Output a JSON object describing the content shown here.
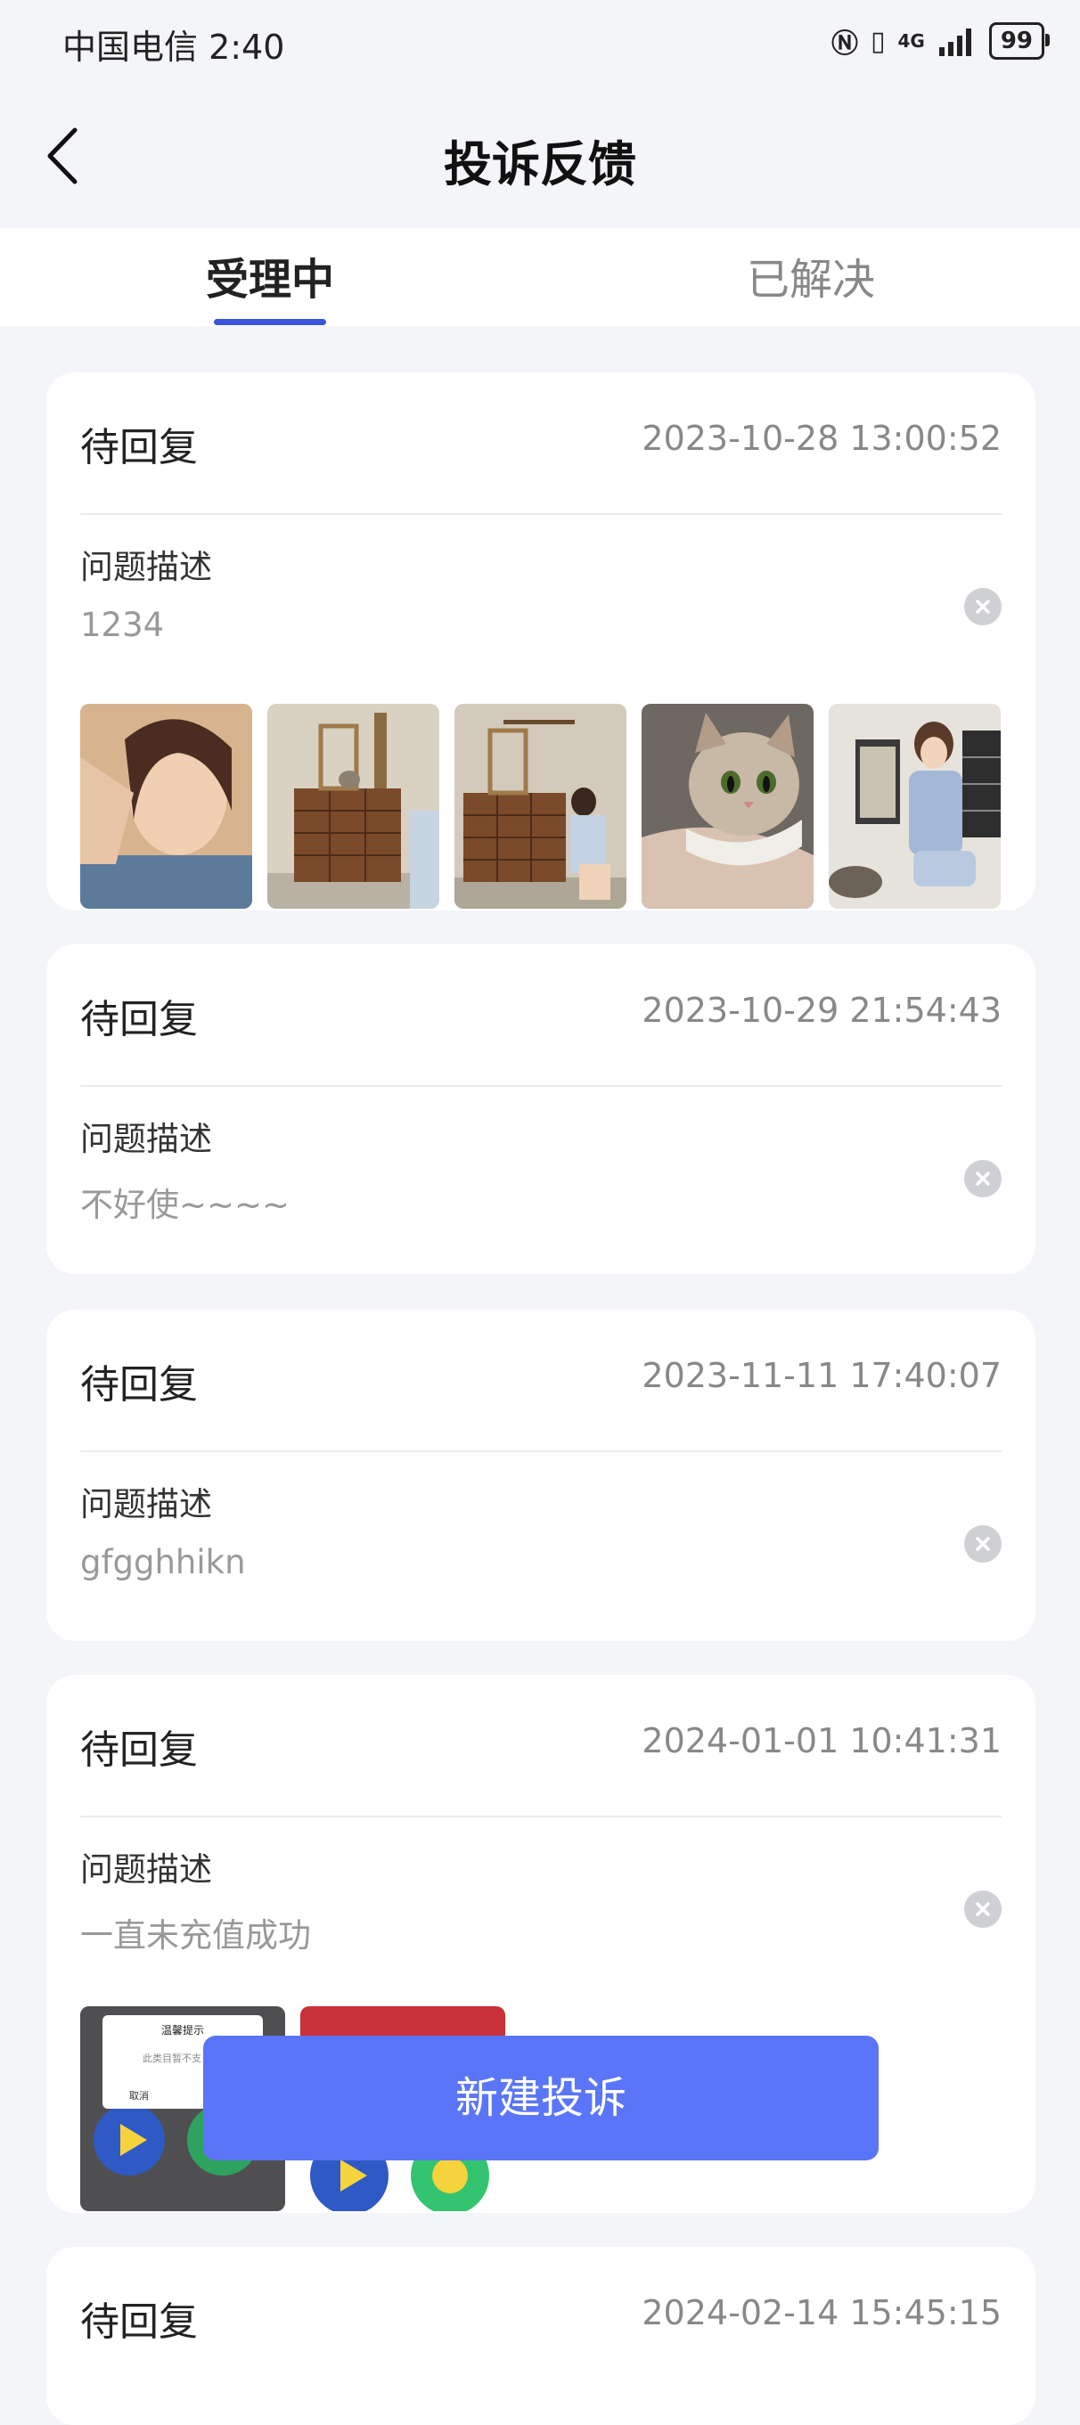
{
  "status_bar": {
    "carrier": "中国电信 2:40",
    "battery": "99",
    "network": "4G"
  },
  "header": {
    "title": "投诉反馈",
    "back_icon": "chevron-left-icon"
  },
  "tabs": [
    {
      "label": "受理中",
      "active": true
    },
    {
      "label": "已解决",
      "active": false
    }
  ],
  "cards": [
    {
      "status": "待回复",
      "date": "2023-10-28 13:00:52",
      "desc_label": "问题描述",
      "desc": "1234",
      "images": 5
    },
    {
      "status": "待回复",
      "date": "2023-10-29 21:54:43",
      "desc_label": "问题描述",
      "desc": "不好使~~~~",
      "images": 0
    },
    {
      "status": "待回复",
      "date": "2023-11-11 17:40:07",
      "desc_label": "问题描述",
      "desc": "gfgghhikn",
      "images": 0
    },
    {
      "status": "待回复",
      "date": "2024-01-01 10:41:31",
      "desc_label": "问题描述",
      "desc": "一直未充值成功",
      "images": 2
    },
    {
      "status": "待回复",
      "date": "2024-02-14 15:45:15"
    }
  ],
  "screenshot_thumb": {
    "title": "温馨提示",
    "body": "此类目暂不支",
    "cancel": "取消"
  },
  "new_complaint_button": "新建投诉",
  "colors": {
    "accent": "#3a55dc",
    "button": "#5a75f7",
    "background": "#f4f5f9"
  }
}
